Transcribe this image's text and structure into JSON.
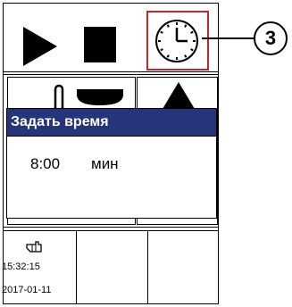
{
  "toolbar": {
    "play_icon": "play-icon",
    "stop_icon": "stop-icon",
    "clock_icon": "clock-icon",
    "highlight_color": "#c0282d"
  },
  "row2": {
    "icons": [
      "temperature-probe-icon",
      "pot-icon",
      "triangle-up-icon"
    ]
  },
  "dialog": {
    "title": "Задать время",
    "time_value": "8:00",
    "time_unit": "мин",
    "title_bg_color": "#26347a"
  },
  "status": {
    "icon": "hand-pointer-icon",
    "time": "15:32:15",
    "date": "2017-01-11"
  },
  "callout": {
    "number": "3"
  }
}
